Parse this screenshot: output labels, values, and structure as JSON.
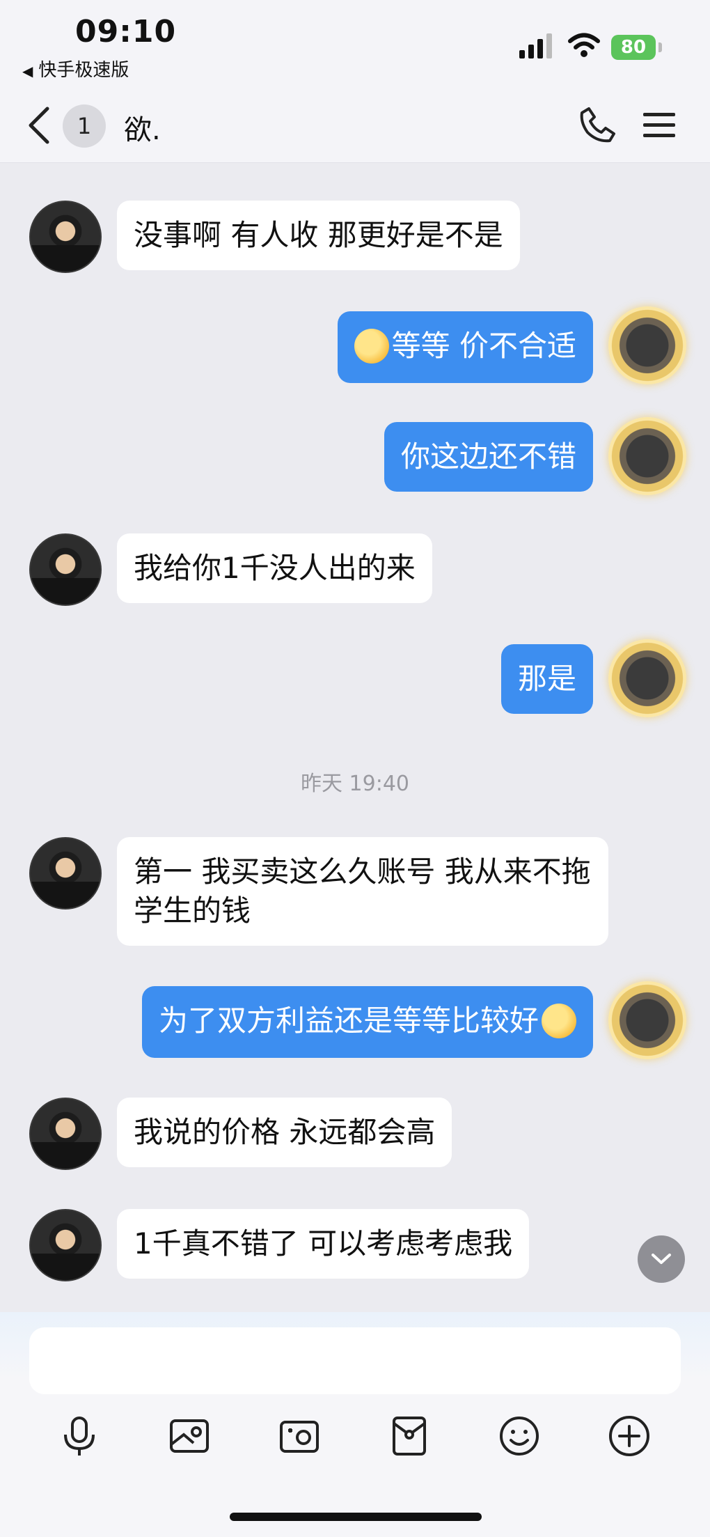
{
  "status_bar": {
    "time": "09:10",
    "back_app": "快手极速版",
    "battery": "80"
  },
  "nav": {
    "unread_count": "1",
    "chat_name": "欲."
  },
  "messages": [
    {
      "side": "in",
      "text": "没事啊 有人收 那更好是不是"
    },
    {
      "side": "out",
      "text": "等等 价不合适",
      "emoji": "laughing-face"
    },
    {
      "side": "out",
      "text": "你这边还不错"
    },
    {
      "side": "in",
      "text": "我给你1千没人出的来"
    },
    {
      "side": "out",
      "text": "那是"
    },
    {
      "side": "in",
      "text": "第一 我买卖这么久账号 我从来不拖学生的钱"
    },
    {
      "side": "out",
      "text": "为了双方利益还是等等比较好",
      "emoji": "laughing-face"
    },
    {
      "side": "in",
      "text": "我说的价格 永远都会高"
    },
    {
      "side": "in",
      "text": "1千真不错了 可以考虑考虑我"
    }
  ],
  "timestamp": "昨天 19:40",
  "toolbar": [
    "microphone-icon",
    "image-icon",
    "camera-icon",
    "red-packet-icon",
    "emoji-icon",
    "plus-icon"
  ],
  "colors": {
    "accent": "#3d8ef0",
    "background": "#ebebf0",
    "battery": "#5bc45b"
  }
}
